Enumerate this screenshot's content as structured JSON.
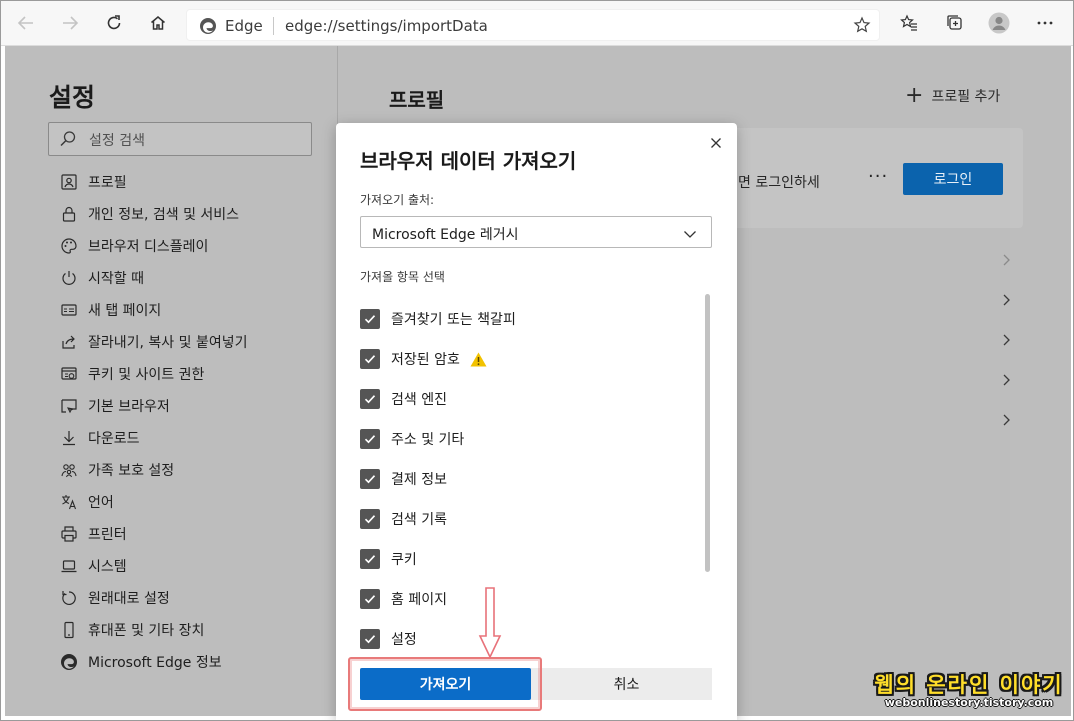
{
  "browser": {
    "brand": "Edge",
    "url": "edge://settings/importData"
  },
  "sidebar": {
    "title": "설정",
    "search_placeholder": "설정 검색",
    "items": [
      {
        "label": "프로필",
        "icon": "profile-card-icon"
      },
      {
        "label": "개인 정보, 검색 및 서비스",
        "icon": "lock-icon"
      },
      {
        "label": "브라우저 디스플레이",
        "icon": "palette-icon"
      },
      {
        "label": "시작할 때",
        "icon": "power-icon"
      },
      {
        "label": "새 탭 페이지",
        "icon": "new-tab-icon"
      },
      {
        "label": "잘라내기, 복사 및 붙여넣기",
        "icon": "share-icon"
      },
      {
        "label": "쿠키 및 사이트 권한",
        "icon": "site-permissions-icon"
      },
      {
        "label": "기본 브라우저",
        "icon": "default-browser-icon"
      },
      {
        "label": "다운로드",
        "icon": "download-icon"
      },
      {
        "label": "가족 보호 설정",
        "icon": "family-icon"
      },
      {
        "label": "언어",
        "icon": "language-icon"
      },
      {
        "label": "프린터",
        "icon": "printer-icon"
      },
      {
        "label": "시스템",
        "icon": "laptop-icon"
      },
      {
        "label": "원래대로 설정",
        "icon": "reset-icon"
      },
      {
        "label": "휴대폰 및 기타 장치",
        "icon": "phone-icon"
      },
      {
        "label": "Microsoft Edge 정보",
        "icon": "edge-logo-icon"
      }
    ]
  },
  "main": {
    "title": "프로필",
    "add_profile": "프로필 추가",
    "card_text": "면 로그인하세",
    "more": "···",
    "login": "로그인"
  },
  "modal": {
    "title": "브라우저 데이터 가져오기",
    "source_label": "가져오기 출처:",
    "source_value": "Microsoft Edge 레거시",
    "items_label": "가져올 항목 선택",
    "items": [
      {
        "label": "즐겨찾기 또는 책갈피",
        "checked": true
      },
      {
        "label": "저장된 암호",
        "checked": true,
        "warning": true
      },
      {
        "label": "검색 엔진",
        "checked": true
      },
      {
        "label": "주소 및 기타",
        "checked": true
      },
      {
        "label": "결제 정보",
        "checked": true
      },
      {
        "label": "검색 기록",
        "checked": true
      },
      {
        "label": "쿠키",
        "checked": true
      },
      {
        "label": "홈 페이지",
        "checked": true
      },
      {
        "label": "설정",
        "checked": true
      }
    ],
    "import_button": "가져오기",
    "cancel_button": "취소"
  },
  "watermark": {
    "line1": "웹의 온라인 이야기",
    "line2": "webonlinestory.tistory.com"
  },
  "colors": {
    "accent": "#0b6cc8",
    "highlight": "#e87a7a",
    "overlay": "#bdbdbd"
  }
}
